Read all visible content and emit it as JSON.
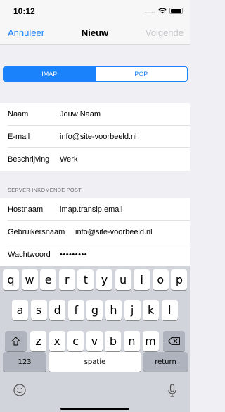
{
  "status_bar": {
    "time": "10:12",
    "signal": "....."
  },
  "nav": {
    "cancel_label": "Annuleer",
    "title": "Nieuw",
    "next_label": "Volgende"
  },
  "segments": [
    {
      "label": "IMAP",
      "selected": true
    },
    {
      "label": "POP",
      "selected": false
    }
  ],
  "account": {
    "name_label": "Naam",
    "name_value": "Jouw Naam",
    "email_label": "E-mail",
    "email_value": "info@site-voorbeeld.nl",
    "description_label": "Beschrijving",
    "description_value": "Werk"
  },
  "incoming": {
    "header": "SERVER INKOMENDE POST",
    "host_label": "Hostnaam",
    "host_value": "imap.transip.email",
    "user_label": "Gebruikersnaam",
    "user_value": "info@site-voorbeeld.nl",
    "password_label": "Wachtwoord",
    "password_value": "•••••••••"
  },
  "keyboard": {
    "row1": [
      "q",
      "w",
      "e",
      "r",
      "t",
      "y",
      "u",
      "i",
      "o",
      "p"
    ],
    "row2": [
      "a",
      "s",
      "d",
      "f",
      "g",
      "h",
      "j",
      "k",
      "l"
    ],
    "row3": [
      "z",
      "x",
      "c",
      "v",
      "b",
      "n",
      "m"
    ],
    "numbers_label": "123",
    "space_label": "spatie",
    "return_label": "return",
    "shift_icon": "shift-icon",
    "delete_icon": "delete-icon"
  },
  "colors": {
    "accent": "#1a82fb",
    "disabled": "#c7c7cc",
    "keyboard_bg": "#d1d4da",
    "function_key": "#aeb3bd"
  }
}
